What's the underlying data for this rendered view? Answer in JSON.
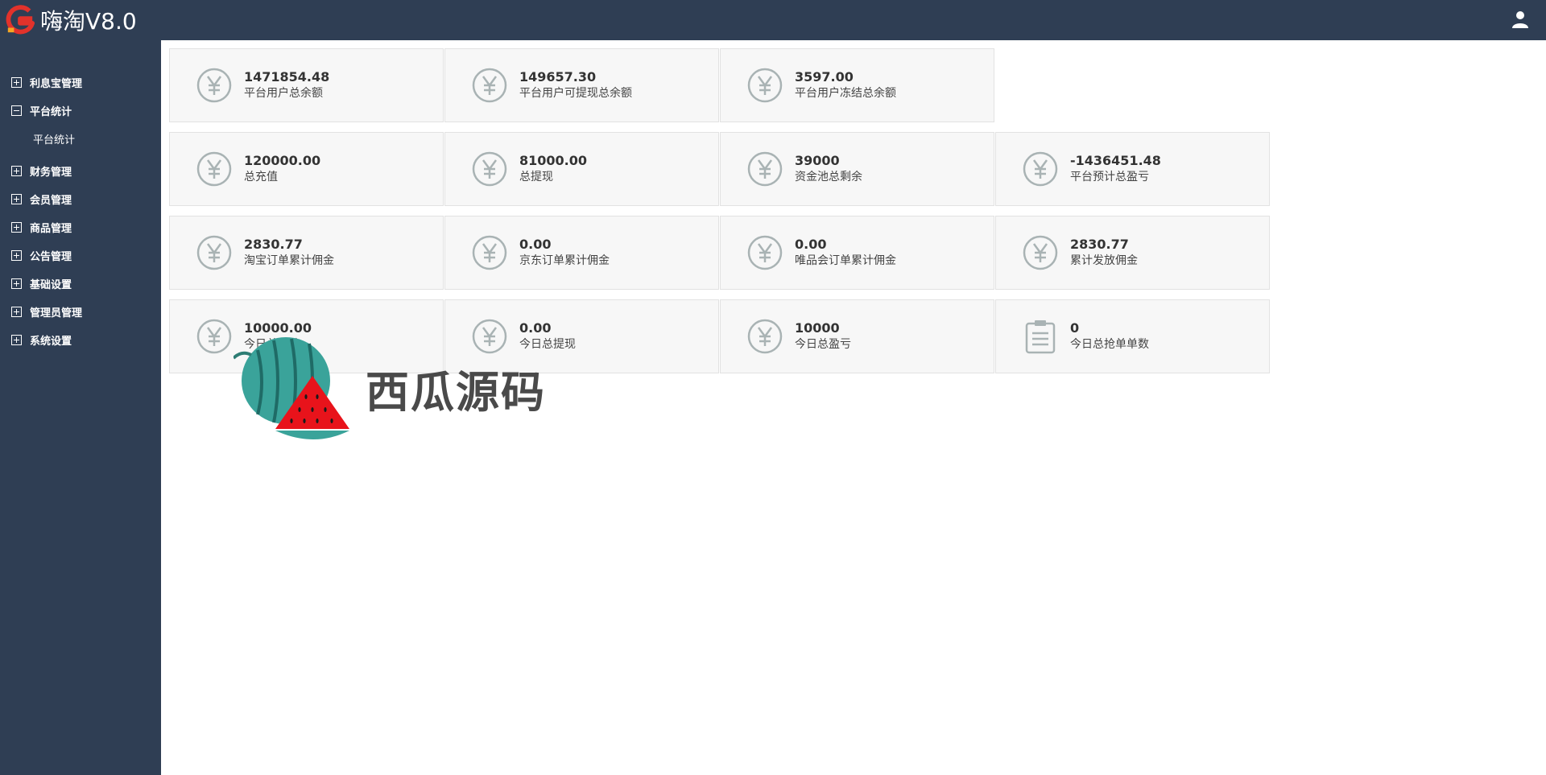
{
  "app": {
    "title": "嗨淘V8.0"
  },
  "header": {
    "user_icon": "user-icon"
  },
  "sidebar": {
    "items": [
      {
        "label": "利息宝管理",
        "expanded": false
      },
      {
        "label": "平台统计",
        "expanded": true,
        "children": [
          {
            "label": "平台统计"
          }
        ]
      },
      {
        "label": "财务管理",
        "expanded": false
      },
      {
        "label": "会员管理",
        "expanded": false
      },
      {
        "label": "商品管理",
        "expanded": false
      },
      {
        "label": "公告管理",
        "expanded": false
      },
      {
        "label": "基础设置",
        "expanded": false
      },
      {
        "label": "管理员管理",
        "expanded": false
      },
      {
        "label": "系统设置",
        "expanded": false
      }
    ]
  },
  "stats": {
    "rows": [
      [
        {
          "value": "1471854.48",
          "label": "平台用户总余额",
          "icon": "yen-icon"
        },
        {
          "value": "149657.30",
          "label": "平台用户可提现总余额",
          "icon": "yen-icon"
        },
        {
          "value": "3597.00",
          "label": "平台用户冻结总余额",
          "icon": "yen-icon"
        }
      ],
      [
        {
          "value": "120000.00",
          "label": "总充值",
          "icon": "yen-icon"
        },
        {
          "value": "81000.00",
          "label": "总提现",
          "icon": "yen-icon"
        },
        {
          "value": "39000",
          "label": "资金池总剩余",
          "icon": "yen-icon"
        },
        {
          "value": "-1436451.48",
          "label": "平台预计总盈亏",
          "icon": "yen-icon"
        }
      ],
      [
        {
          "value": "2830.77",
          "label": "淘宝订单累计佣金",
          "icon": "yen-icon"
        },
        {
          "value": "0.00",
          "label": "京东订单累计佣金",
          "icon": "yen-icon"
        },
        {
          "value": "0.00",
          "label": "唯品会订单累计佣金",
          "icon": "yen-icon"
        },
        {
          "value": "2830.77",
          "label": "累计发放佣金",
          "icon": "yen-icon"
        }
      ],
      [
        {
          "value": "10000.00",
          "label": "今日总充值",
          "icon": "yen-icon"
        },
        {
          "value": "0.00",
          "label": "今日总提现",
          "icon": "yen-icon"
        },
        {
          "value": "10000",
          "label": "今日总盈亏",
          "icon": "yen-icon"
        },
        {
          "value": "0",
          "label": "今日总抢单单数",
          "icon": "clipboard-icon"
        }
      ]
    ]
  },
  "watermark": {
    "text": "西瓜源码"
  },
  "colors": {
    "sidebar_bg": "#2f3e54",
    "card_bg": "#f7f7f7",
    "icon_gray": "#a9b3b4",
    "logo_red": "#e2322b"
  }
}
